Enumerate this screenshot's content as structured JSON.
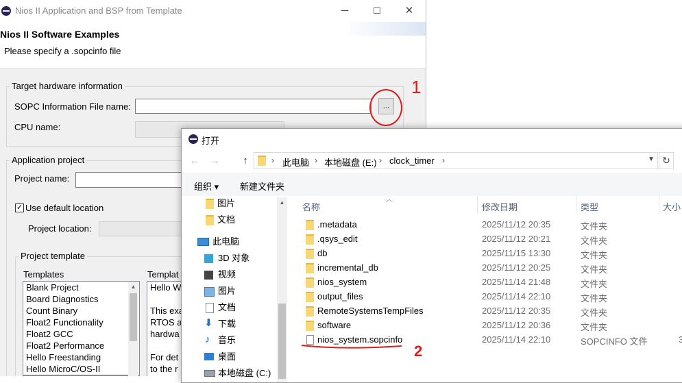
{
  "wizard": {
    "title": "Nios II Application and BSP from Template",
    "controls": {
      "minimize": "─",
      "maximize": "☐",
      "close": "✕"
    },
    "header_title": "Nios II Software Examples",
    "header_subtitle": "Please specify a .sopcinfo file",
    "target_group": "Target hardware information",
    "sopc_label": "SOPC Information File name:",
    "sopc_value": "",
    "browse_label": "...",
    "cpu_label": "CPU name:",
    "app_group": "Application project",
    "project_name_label": "Project name:",
    "project_name_value": "",
    "use_default_label": "Use default location",
    "use_default_checked": true,
    "project_location_label": "Project location:",
    "template_group": "Project template",
    "templates_label": "Templates",
    "templates": [
      "Blank Project",
      "Board Diagnostics",
      "Count Binary",
      "Float2 Functionality",
      "Float2 GCC",
      "Float2 Performance",
      "Hello Freestanding",
      "Hello MicroC/OS-II"
    ],
    "selected_template": "Hello MicroC/OS-II",
    "desc_label": "Templat",
    "desc_lines": [
      "Hello W",
      "",
      "This exa",
      "RTOS a",
      "hardwa",
      "",
      "For det",
      "to the r"
    ]
  },
  "dialog": {
    "title": "打开",
    "nav": {
      "back": "←",
      "forward": "→",
      "up": "↑"
    },
    "breadcrumb": [
      "此电脑",
      "本地磁盘 (E:)",
      "clock_timer"
    ],
    "refresh_icon": "refresh-icon",
    "organize_label": "组织 ▾",
    "new_folder_label": "新建文件夹",
    "nav_items": [
      {
        "label": "图片",
        "icon": "folder-icon"
      },
      {
        "label": "文档",
        "icon": "folder-icon"
      },
      {
        "label": "此电脑",
        "icon": "computer-icon"
      },
      {
        "label": "3D 对象",
        "icon": "cube-icon"
      },
      {
        "label": "视频",
        "icon": "video-icon"
      },
      {
        "label": "图片",
        "icon": "picture-icon"
      },
      {
        "label": "文档",
        "icon": "document-icon"
      },
      {
        "label": "下载",
        "icon": "download-icon"
      },
      {
        "label": "音乐",
        "icon": "music-icon"
      },
      {
        "label": "桌面",
        "icon": "desktop-icon"
      },
      {
        "label": "本地磁盘 (C:)",
        "icon": "drive-icon"
      }
    ],
    "columns": [
      "名称",
      "修改日期",
      "类型",
      "大小"
    ],
    "files": [
      {
        "name": ".metadata",
        "date": "2025/11/12 20:35",
        "type": "文件夹",
        "size": ""
      },
      {
        "name": ".qsys_edit",
        "date": "2025/11/12 20:21",
        "type": "文件夹",
        "size": ""
      },
      {
        "name": "db",
        "date": "2025/11/15 13:30",
        "type": "文件夹",
        "size": ""
      },
      {
        "name": "incremental_db",
        "date": "2025/11/12 20:25",
        "type": "文件夹",
        "size": ""
      },
      {
        "name": "nios_system",
        "date": "2025/11/14 21:48",
        "type": "文件夹",
        "size": ""
      },
      {
        "name": "output_files",
        "date": "2025/11/14 22:10",
        "type": "文件夹",
        "size": ""
      },
      {
        "name": "RemoteSystemsTempFiles",
        "date": "2025/11/12 20:35",
        "type": "文件夹",
        "size": ""
      },
      {
        "name": "software",
        "date": "2025/11/12 20:36",
        "type": "文件夹",
        "size": ""
      },
      {
        "name": "nios_system.sopcinfo",
        "date": "2025/11/14 22:10",
        "type": "SOPCINFO 文件",
        "size": "3"
      }
    ]
  },
  "annotations": {
    "step1": "1",
    "step2": "2",
    "color": "#e01b1b"
  }
}
